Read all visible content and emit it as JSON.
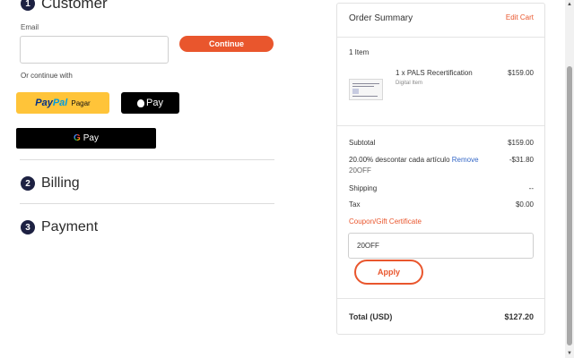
{
  "customer": {
    "step_number": "1",
    "title": "Customer",
    "email_label": "Email",
    "email_value": "",
    "continue_label": "Continue",
    "alt_label": "Or continue with",
    "paypal": {
      "brand_1": "Pay",
      "brand_2": "Pal",
      "sub": "Pagar"
    },
    "applepay_label": "Pay",
    "gpay": {
      "g": "G",
      "label": "Pay"
    }
  },
  "billing": {
    "step_number": "2",
    "title": "Billing"
  },
  "payment": {
    "step_number": "3",
    "title": "Payment"
  },
  "summary": {
    "title": "Order Summary",
    "edit_label": "Edit Cart",
    "item_count": "1 Item",
    "item": {
      "name": "1 x PALS Recertification",
      "sub": "Digital Item",
      "price": "$159.00",
      "thumb_icon": "product-thumbnail"
    },
    "subtotal": {
      "label": "Subtotal",
      "value": "$159.00"
    },
    "discount": {
      "label": "20.00% descontar cada artículo",
      "remove_label": "Remove",
      "code": "20OFF",
      "value": "-$31.80"
    },
    "shipping": {
      "label": "Shipping",
      "value": "--"
    },
    "tax": {
      "label": "Tax",
      "value": "$0.00"
    },
    "coupon_label": "Coupon/Gift Certificate",
    "coupon_value": "20OFF",
    "apply_label": "Apply",
    "total": {
      "label": "Total (USD)",
      "value": "$127.20"
    }
  },
  "colors": {
    "accent": "#e9562d",
    "step_badge": "#1d2142",
    "link": "#3568c7",
    "paypal_yellow": "#ffc439"
  }
}
